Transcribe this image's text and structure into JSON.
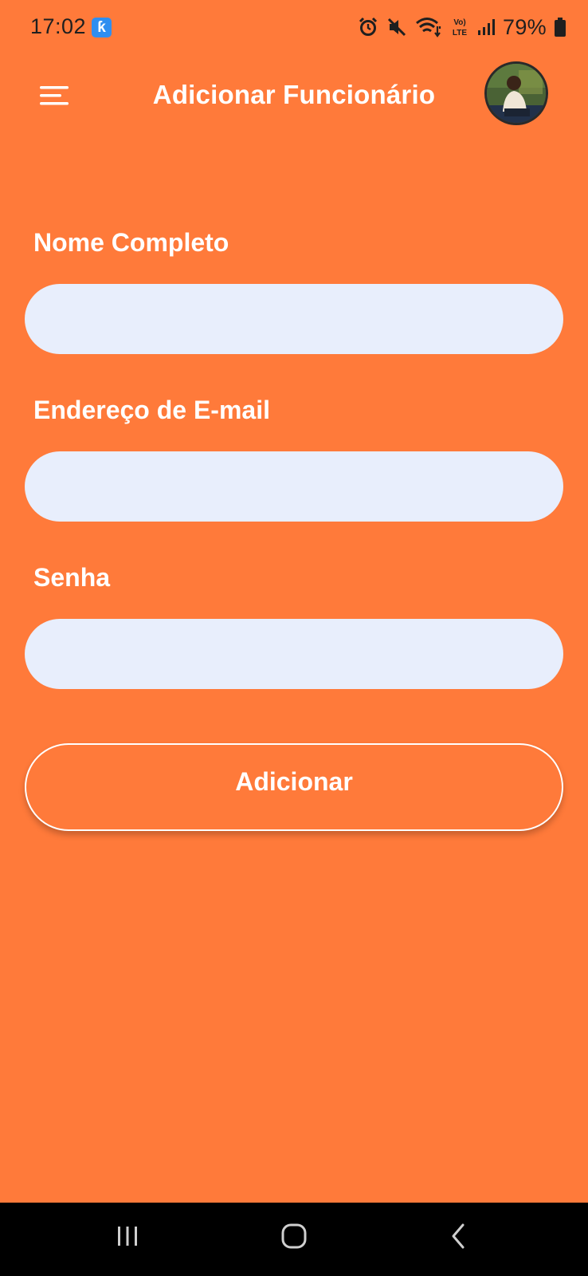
{
  "status_bar": {
    "time": "17:02",
    "battery_percent": "79%",
    "icons": [
      "notification-app-icon",
      "alarm-icon",
      "mute-icon",
      "wifi-icon",
      "volte-lte-icon",
      "signal-icon",
      "battery-icon"
    ]
  },
  "header": {
    "title": "Adicionar Funcionário",
    "menu_icon": "hamburger-menu-icon",
    "avatar": "profile-avatar"
  },
  "form": {
    "fields": [
      {
        "label": "Nome Completo",
        "value": "",
        "placeholder": ""
      },
      {
        "label": "Endereço de E-mail",
        "value": "",
        "placeholder": ""
      },
      {
        "label": "Senha",
        "value": "",
        "placeholder": ""
      }
    ],
    "submit_label": "Adicionar"
  },
  "colors": {
    "background": "#FF7A3A",
    "input_background": "#E8EEFC",
    "text": "#FFFFFF",
    "nav_bar": "#000000"
  },
  "nav_bar": {
    "icons": [
      "recent-apps-icon",
      "home-icon",
      "back-icon"
    ]
  }
}
